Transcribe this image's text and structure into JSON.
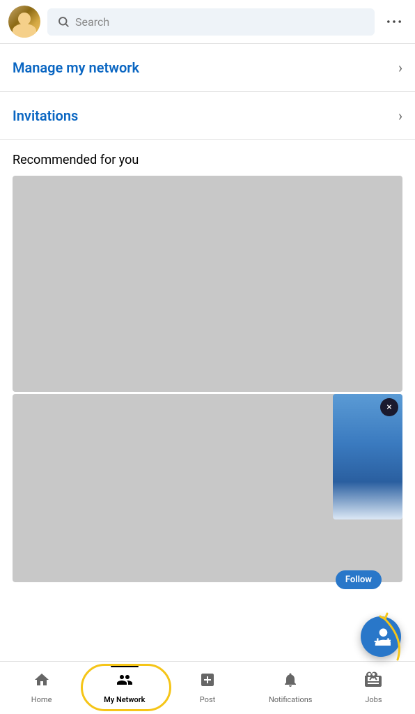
{
  "header": {
    "search_placeholder": "Search",
    "messaging_icon": "..."
  },
  "nav_items": [
    {
      "label": "Manage my network",
      "id": "manage-network"
    },
    {
      "label": "Invitations",
      "id": "invitations"
    }
  ],
  "recommended_section": {
    "title": "Recommended for you"
  },
  "popup": {
    "follow_label": "Follow",
    "close_label": "×"
  },
  "bottom_nav": {
    "tabs": [
      {
        "id": "home",
        "label": "Home",
        "icon": "🏠",
        "active": false
      },
      {
        "id": "my-network",
        "label": "My Network",
        "icon": "👥",
        "active": true
      },
      {
        "id": "post",
        "label": "Post",
        "icon": "➕",
        "active": false
      },
      {
        "id": "notifications",
        "label": "Notifications",
        "icon": "🔔",
        "active": false
      },
      {
        "id": "jobs",
        "label": "Jobs",
        "icon": "💼",
        "active": false
      }
    ]
  }
}
